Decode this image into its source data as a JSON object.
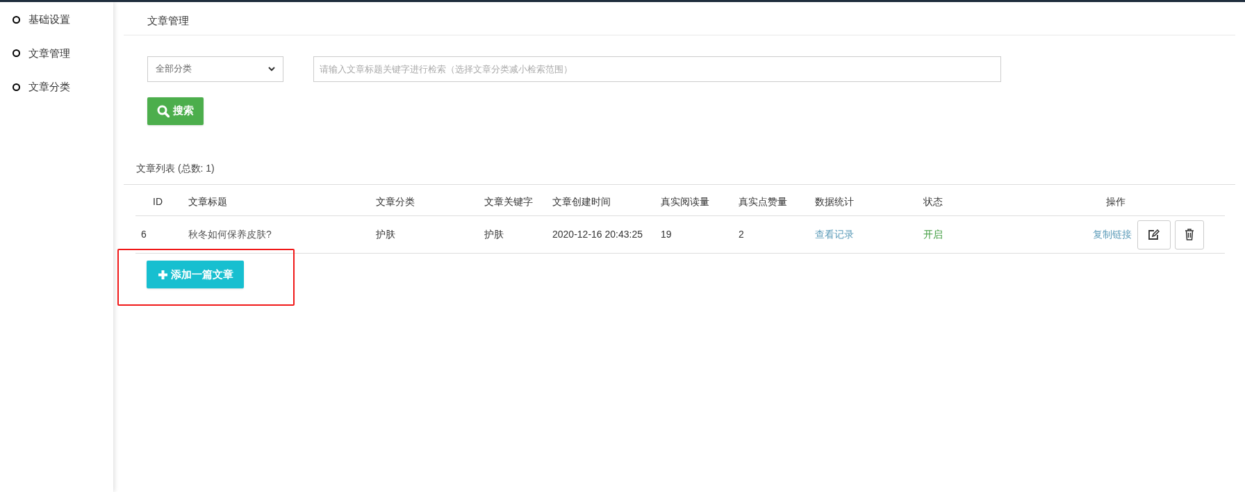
{
  "sidebar": {
    "items": [
      {
        "label": "基础设置",
        "selected": false
      },
      {
        "label": "文章管理",
        "selected": false
      },
      {
        "label": "文章分类",
        "selected": false
      }
    ]
  },
  "page_title": "文章管理",
  "filter": {
    "category_select": "全部分类",
    "search": {
      "placeholder": "请输入文章标题关键字进行检索（选择文章分类减小检索范围）"
    },
    "search_button": "搜索"
  },
  "list_title": "文章列表 (总数: 1)",
  "table": {
    "columns": [
      "ID",
      "文章标题",
      "文章分类",
      "文章关键字",
      "文章创建时间",
      "真实阅读量",
      "真实点赞量",
      "数据统计",
      "状态",
      "操作"
    ],
    "rows": [
      {
        "id": "6",
        "title": "秋冬如何保养皮肤?",
        "category": "护肤",
        "keyword": "护肤",
        "created": "2020-12-16 20:43:25",
        "reads": "19",
        "likes": "2",
        "stats_link": "查看记录",
        "status": "开启",
        "enabled": true,
        "copy_link": "复制链接"
      }
    ]
  },
  "add_button": "添加一篇文章"
}
